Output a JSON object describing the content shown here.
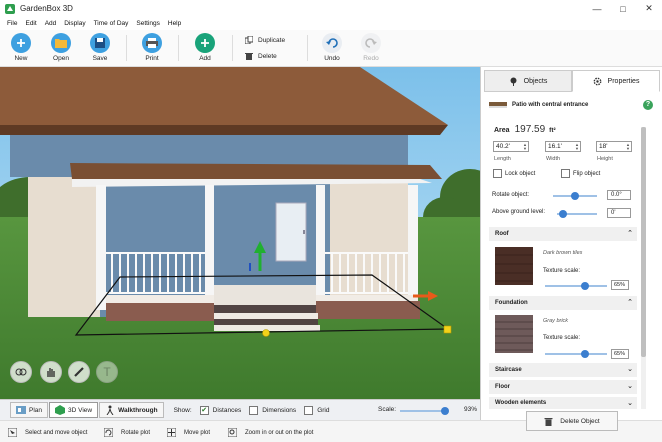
{
  "app": {
    "title": "GardenBox 3D"
  },
  "menu": [
    "File",
    "Edit",
    "Add",
    "Display",
    "Time of Day",
    "Settings",
    "Help"
  ],
  "toolbar": {
    "new": "New",
    "open": "Open",
    "save": "Save",
    "print": "Print",
    "add": "Add",
    "duplicate": "Duplicate",
    "delete": "Delete",
    "undo": "Undo",
    "redo": "Redo"
  },
  "viewbar": {
    "plan": "Plan",
    "view3d": "3D View",
    "walkthrough": "Walkthrough",
    "show": "Show:",
    "distances": "Distances",
    "dimensions": "Dimensions",
    "grid": "Grid",
    "scale_label": "Scale:",
    "scale_value": "93%",
    "scale_fraction": 0.93,
    "distances_checked": true,
    "dimensions_checked": false,
    "grid_checked": false
  },
  "status": [
    "Select and move object",
    "Rotate plot",
    "Move plot",
    "Zoom in or out on the plot"
  ],
  "panel": {
    "tab_objects": "Objects",
    "tab_properties": "Properties",
    "object_name": "Patio with central entrance",
    "help": "?",
    "area_label": "Area",
    "area_value": "197.59",
    "area_unit": "ft²",
    "length_value": "40.2'",
    "width_value": "16.1'",
    "height_value": "18'",
    "length_label": "Length",
    "width_label": "Width",
    "height_label": "Height",
    "lock_label": "Lock object",
    "flip_label": "Flip object",
    "rotate_label": "Rotate object:",
    "rotate_value": "0.0°",
    "ground_label": "Above ground level:",
    "ground_value": "0'",
    "roof_title": "Roof",
    "roof_material": "Dark brown tiles",
    "roof_texture_label": "Texture scale:",
    "roof_texture_value": "65%",
    "foundation_title": "Foundation",
    "foundation_material": "Gray brick",
    "foundation_texture_label": "Texture scale:",
    "foundation_texture_value": "65%",
    "staircase_title": "Staircase",
    "floor_title": "Floor",
    "wooden_title": "Wooden elements",
    "delete_button": "Delete Object"
  },
  "colors": {
    "accent": "#3b7ecf",
    "grass": "#4e8a3a",
    "sky": "#9fd0ee",
    "roof": "#8d5b3a",
    "wall": "#6a8bab",
    "green_icon": "#19a37a"
  }
}
